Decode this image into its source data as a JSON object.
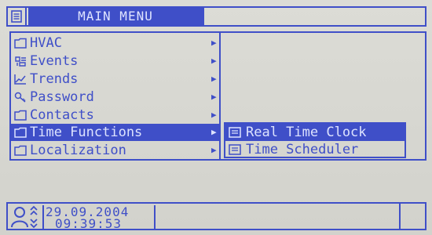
{
  "header": {
    "title": "MAIN MENU",
    "menu_icon": "list-icon"
  },
  "menu": {
    "items": [
      {
        "label": "HVAC",
        "icon": "folder-icon",
        "has_submenu": true
      },
      {
        "label": "Events",
        "icon": "events-icon",
        "has_submenu": true
      },
      {
        "label": "Trends",
        "icon": "trend-icon",
        "has_submenu": true
      },
      {
        "label": "Password",
        "icon": "key-icon",
        "has_submenu": true
      },
      {
        "label": "Contacts",
        "icon": "folder-icon",
        "has_submenu": true
      },
      {
        "label": "Time Functions",
        "icon": "folder-icon",
        "has_submenu": true,
        "selected": true
      },
      {
        "label": "Localization",
        "icon": "folder-icon",
        "has_submenu": true
      }
    ],
    "arrow": "▶"
  },
  "submenu": {
    "items": [
      {
        "label": "Real Time Clock",
        "icon": "doc-icon",
        "selected": true
      },
      {
        "label": "Time Scheduler",
        "icon": "doc-icon"
      }
    ]
  },
  "status": {
    "date": "29.09.2004",
    "time": "09:39:53",
    "user_icon": "user-icon"
  },
  "colors": {
    "ink": "#3f4fc8",
    "background": "#d6d6d0"
  }
}
